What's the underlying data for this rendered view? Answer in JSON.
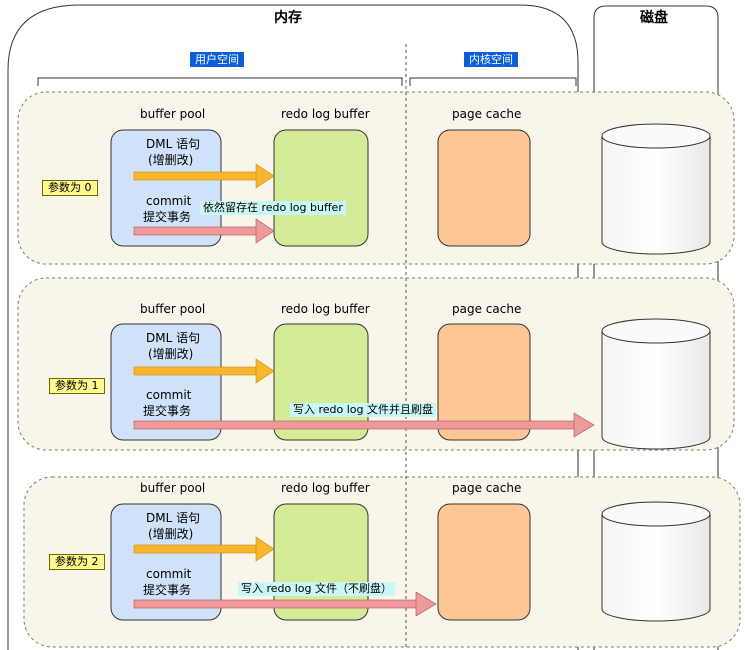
{
  "memory": {
    "title": "内存",
    "user_space": "用户空间",
    "kernel_space": "内核空间"
  },
  "disk": {
    "title": "磁盘"
  },
  "labels": {
    "buffer_pool": "buffer pool",
    "redo_log_buffer": "redo log buffer",
    "page_cache": "page cache",
    "dml_line1": "DML 语句",
    "dml_line2": "(增删改)",
    "commit_line1": "commit",
    "commit_line2": "提交事务"
  },
  "rows": [
    {
      "param": "参数为 0",
      "note": "依然留存在 redo log buffer"
    },
    {
      "param": "参数为 1",
      "note": "写入 redo log 文件并且刷盘"
    },
    {
      "param": "参数为 2",
      "note": "写入 redo log 文件（不刷盘）"
    }
  ],
  "colors": {
    "panel_bg": "#f8f5ea",
    "buffer_pool": "#cfe2f9",
    "redo_log_buffer": "#d4ec97",
    "page_cache": "#fcc795",
    "dml_arrow": "#f8b52d",
    "commit_arrow": "#ef9a9a"
  }
}
